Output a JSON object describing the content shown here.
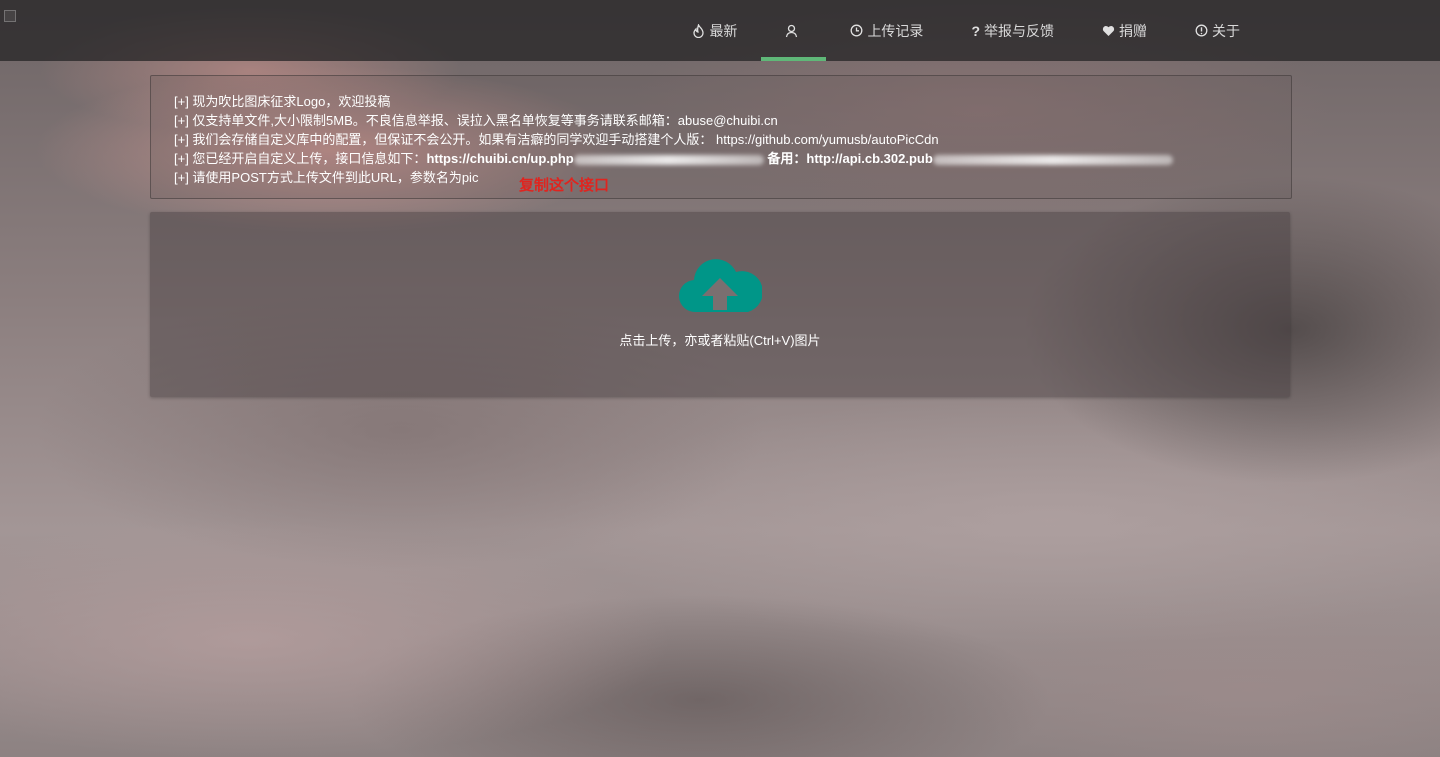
{
  "nav": {
    "items": [
      {
        "label": "最新",
        "icon": "fire-icon"
      },
      {
        "label": "",
        "icon": "user-icon",
        "active": true
      },
      {
        "label": "上传记录",
        "icon": "clock-icon"
      },
      {
        "label": "举报与反馈",
        "icon": "question-icon"
      },
      {
        "label": "捐赠",
        "icon": "heart-icon"
      },
      {
        "label": "关于",
        "icon": "info-icon"
      }
    ],
    "active_color": "#5fb878"
  },
  "notice": {
    "line1": "[+] 现为吹比图床征求Logo，欢迎投稿",
    "line2": "[+] 仅支持单文件,大小限制5MB。不良信息举报、误拉入黑名单恢复等事务请联系邮箱：abuse@chuibi.cn",
    "line3": "[+] 我们会存储自定义库中的配置，但保证不会公开。如果有洁癖的同学欢迎手动搭建个人版： https://github.com/yumusb/autoPicCdn",
    "line4_prefix": "[+] 您已经开启自定义上传，接口信息如下：",
    "line4_url1": "https://chuibi.cn/up.php",
    "line4_backup_label": "备用：",
    "line4_url2": "http://api.cb.302.pub",
    "line5": "[+] 请使用POST方式上传文件到此URL，参数名为pic"
  },
  "copy_hint": {
    "text": "复制这个接口",
    "color": "#e0241f"
  },
  "upload": {
    "text": "点击上传，亦或者粘贴(Ctrl+V)图片",
    "icon": "cloud-upload-icon",
    "icon_color": "#009688"
  }
}
